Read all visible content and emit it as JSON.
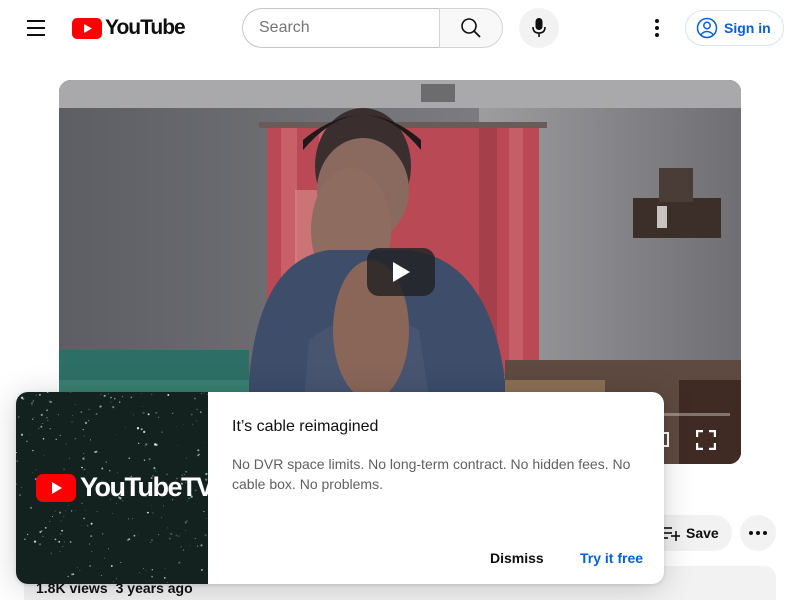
{
  "header": {
    "logo_text": "YouTube",
    "search_placeholder": "Search",
    "signin_label": "Sign in"
  },
  "player": {
    "play_icon": "play-icon",
    "fullscreen_icon": "fullscreen-icon"
  },
  "actions": {
    "save_label": "Save"
  },
  "description": {
    "views": "1.8K views",
    "age": "3 years ago"
  },
  "promo": {
    "logo_text": "YouTubeTV",
    "title": "It’s cable reimagined",
    "body": "No DVR space limits. No long-term contract. No hidden fees. No cable box. No problems.",
    "dismiss_label": "Dismiss",
    "try_label": "Try it free"
  },
  "colors": {
    "brand_red": "#ff0000",
    "link_blue": "#065fd4"
  }
}
